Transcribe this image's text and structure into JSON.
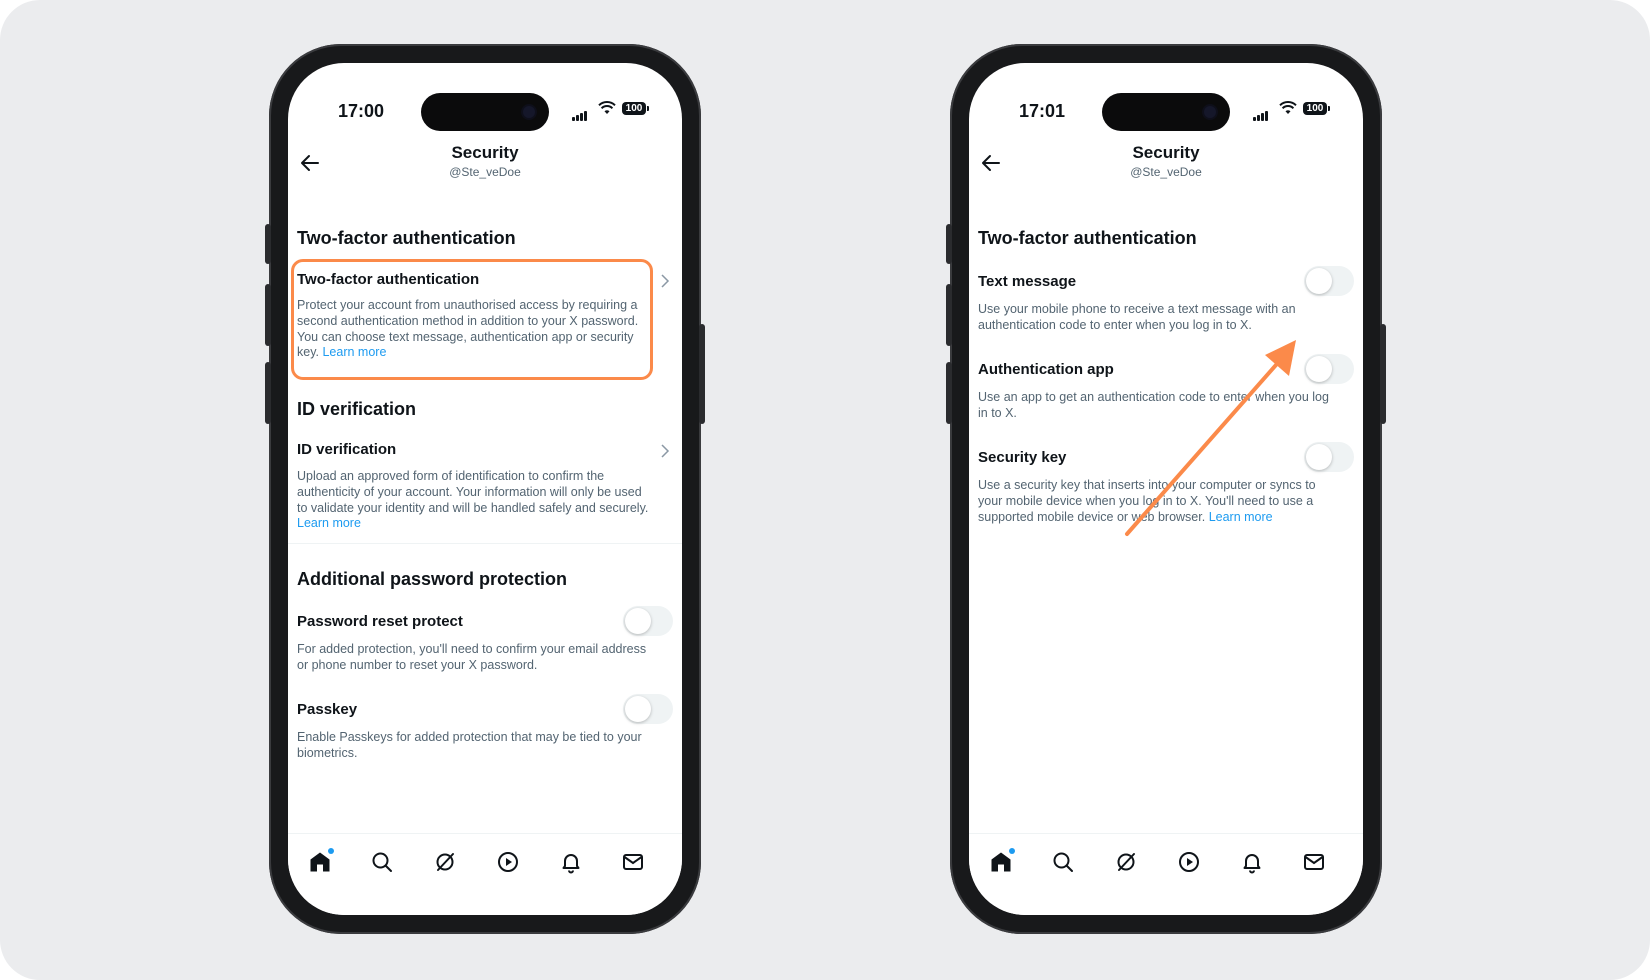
{
  "annotation_color": "#fb8a4a",
  "link_color": "#1d9bf0",
  "left_phone": {
    "time": "17:00",
    "battery": "100",
    "header": {
      "title": "Security",
      "handle": "@Ste_veDoe"
    },
    "sections": {
      "two_factor": {
        "heading": "Two-factor authentication",
        "item_title": "Two-factor authentication",
        "item_desc": "Protect your account from unauthorised access by requiring a second authentication method in addition to your X password. You can choose text message, authentication app or security key.",
        "learn_more": "Learn more"
      },
      "id_verification": {
        "heading": "ID verification",
        "item_title": "ID verification",
        "item_desc": "Upload an approved form of identification to confirm the authenticity of your account. Your information will only be used to validate your identity and will be handled safely and securely.",
        "learn_more": "Learn more"
      },
      "password_protection": {
        "heading": "Additional password protection",
        "reset": {
          "title": "Password reset protect",
          "desc": "For added protection, you'll need to confirm your email address or phone number to reset your X password.",
          "enabled": false
        },
        "passkey": {
          "title": "Passkey",
          "desc": "Enable Passkeys for added protection that may be tied to your biometrics.",
          "enabled": false
        }
      }
    }
  },
  "right_phone": {
    "time": "17:01",
    "battery": "100",
    "header": {
      "title": "Security",
      "handle": "@Ste_veDoe"
    },
    "heading": "Two-factor authentication",
    "text_message": {
      "title": "Text message",
      "desc": "Use your mobile phone to receive a text message with an authentication code to enter when you log in to X.",
      "enabled": false
    },
    "auth_app": {
      "title": "Authentication app",
      "desc": "Use an app to get an authentication code to enter when you log in to X.",
      "enabled": false
    },
    "security_key": {
      "title": "Security key",
      "desc": "Use a security key that inserts into your computer or syncs to your mobile device when you log in to X. You'll need to use a supported mobile device or web browser.",
      "learn_more": "Learn more",
      "enabled": false
    }
  },
  "tabbar_icons": [
    "home-icon",
    "search-icon",
    "grok-icon",
    "video-icon",
    "notifications-icon",
    "messages-icon"
  ]
}
